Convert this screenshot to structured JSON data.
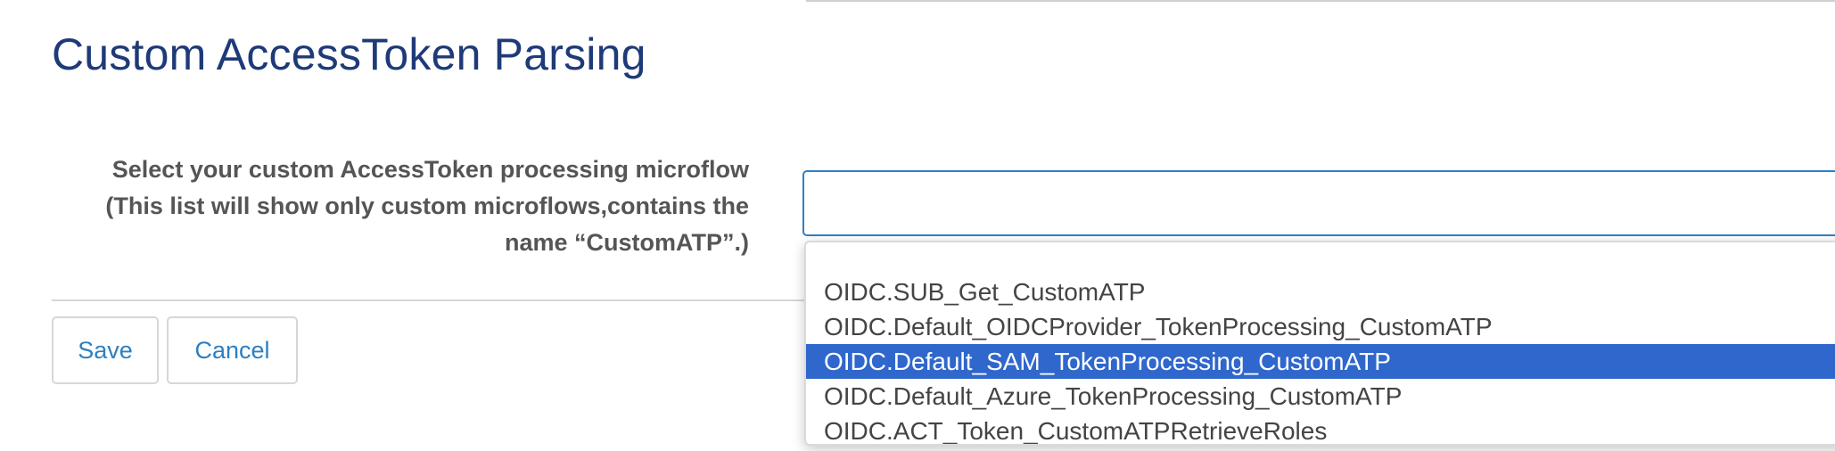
{
  "page": {
    "title": "Custom AccessToken Parsing"
  },
  "form": {
    "label_line1": "Select your custom AccessToken processing microflow",
    "label_line2": "(This list will show only custom microflows,contains the",
    "label_line3": "name “CustomATP”.)",
    "select_value": ""
  },
  "dropdown": {
    "options": [
      {
        "label": ""
      },
      {
        "label": "OIDC.SUB_Get_CustomATP"
      },
      {
        "label": "OIDC.Default_OIDCProvider_TokenProcessing_CustomATP"
      },
      {
        "label": "OIDC.Default_SAM_TokenProcessing_CustomATP",
        "selected": true
      },
      {
        "label": "OIDC.Default_Azure_TokenProcessing_CustomATP"
      },
      {
        "label": "OIDC.ACT_Token_CustomATPRetrieveRoles"
      }
    ],
    "highlight_color": "#2f67cc"
  },
  "buttons": {
    "save_label": "Save",
    "cancel_label": "Cancel"
  },
  "colors": {
    "title": "#1e3a78",
    "accent": "#2d7fc1"
  }
}
